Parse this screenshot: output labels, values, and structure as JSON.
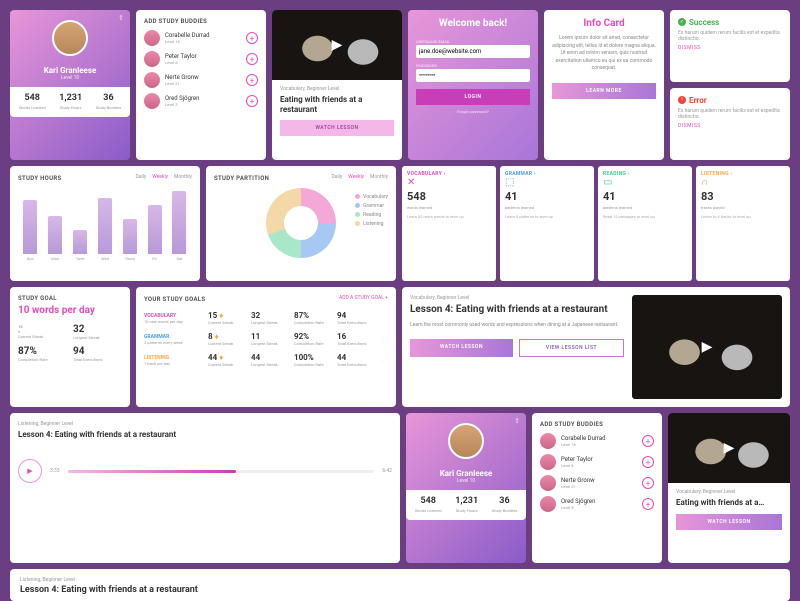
{
  "profile": {
    "name": "Kari Granleese",
    "level": "Level 10",
    "stats": [
      {
        "v": "548",
        "l": "Words Learned"
      },
      {
        "v": "1,231",
        "l": "Study Hours"
      },
      {
        "v": "36",
        "l": "Study Buddies"
      }
    ]
  },
  "buddies": {
    "title": "ADD STUDY BUDDIES",
    "list": [
      {
        "n": "Corabelle Durrad",
        "l": "Level 16"
      },
      {
        "n": "Peter Taylor",
        "l": "Level 8"
      },
      {
        "n": "Nerte Gronw",
        "l": "Level 21"
      },
      {
        "n": "Ored Sjögren",
        "l": "Level 5"
      }
    ]
  },
  "lesson1": {
    "tag": "Vocabulary, Beginner Level",
    "title": "Eating with friends at a restaurant",
    "btn": "WATCH LESSON"
  },
  "login": {
    "title": "Welcome back!",
    "u_label": "USERNAME/EMAIL",
    "u_val": "jane.doe@website.com",
    "p_label": "PASSWORD",
    "p_val": "••••••••",
    "btn": "LOGIN",
    "forgot": "Forgot password?"
  },
  "info": {
    "title": "Info Card",
    "body": "Lorem ipsum dolor sit amet, consectetur adipiscing elit, tellus id et dolore magna aliqua. Ut enim ad minim veniam, quis nostrud exercitation ullamco eu qui ex ea commodo consequat.",
    "btn": "LEARN MORE"
  },
  "notif_success": {
    "title": "Success",
    "body": "Es harum quidem rerum facilis est et expedita distinctio.",
    "btn": "DISMISS"
  },
  "notif_error": {
    "title": "Error",
    "body": "Es harum quidem rerum facilis est et expedita distinctio.",
    "btn": "DISMISS"
  },
  "study_hours": {
    "title": "STUDY HOURS",
    "tabs": [
      "Daily",
      "Weekly",
      "Monthly"
    ],
    "active": "Weekly"
  },
  "partition": {
    "title": "STUDY PARTITION",
    "tabs": [
      "Daily",
      "Weekly",
      "Monthly"
    ],
    "active": "Weekly",
    "legend": [
      "Vocabulary",
      "Grammar",
      "Reading",
      "Listening"
    ]
  },
  "metrics": {
    "vocab": {
      "t": "VOCABULARY ›",
      "v": "548",
      "s": "words learned",
      "h": "Learn 32 more words to level up"
    },
    "gram": {
      "t": "GRAMMAR ›",
      "v": "41",
      "s": "patterns learned",
      "h": "Learn 8 patterns to level up"
    },
    "read": {
      "t": "READING ›",
      "v": "41",
      "s": "patterns learned",
      "h": "Read 12 passages to level up"
    },
    "list": {
      "t": "LISTENING ›",
      "v": "83",
      "s": "tracks played",
      "h": "Listen to 4 tracks to level up"
    }
  },
  "goal": {
    "title": "STUDY GOAL",
    "main": "10 words per day",
    "stats": [
      {
        "v": "15",
        "l": "Current Streak",
        "flame": true
      },
      {
        "v": "32",
        "l": "Longest Streak"
      },
      {
        "v": "87%",
        "l": "Completion Rate"
      },
      {
        "v": "94",
        "l": "Total Executions"
      }
    ]
  },
  "goals": {
    "title": "YOUR STUDY GOALS",
    "add": "ADD A STUDY GOAL +",
    "rows": [
      {
        "cat": "VOCABULARY",
        "desc": "10 new words per day",
        "color": "#e84bb8",
        "c": [
          {
            "v": "15",
            "l": "Current Streak",
            "f": true
          },
          {
            "v": "32",
            "l": "Longest Streak"
          },
          {
            "v": "87%",
            "l": "Completion Rate"
          },
          {
            "v": "94",
            "l": "Total Executions"
          }
        ]
      },
      {
        "cat": "GRAMMAR",
        "desc": "2 patterns every week",
        "color": "#4a9fd8",
        "c": [
          {
            "v": "8",
            "l": "Current Streak",
            "f": true
          },
          {
            "v": "11",
            "l": "Longest Streak"
          },
          {
            "v": "92%",
            "l": "Completion Rate"
          },
          {
            "v": "16",
            "l": "Total Executions"
          }
        ]
      },
      {
        "cat": "LISTENING",
        "desc": "1 track per day",
        "color": "#f4a848",
        "c": [
          {
            "v": "44",
            "l": "Current Streak",
            "f": true
          },
          {
            "v": "44",
            "l": "Longest Streak"
          },
          {
            "v": "100%",
            "l": "Completion Rate"
          },
          {
            "v": "44",
            "l": "Total Executions"
          }
        ]
      }
    ]
  },
  "lesson2": {
    "tag": "Vocabulary, Beginner Level",
    "title": "Lesson 4: Eating with friends at a restaurant",
    "body": "Learn the most commonly used words and expressions when dining at a Japanese restaurant.",
    "b1": "WATCH LESSON",
    "b2": "VIEW LESSON LIST"
  },
  "player": {
    "tag": "Listening, Beginner Level",
    "title": "Lesson 4: Eating with friends at a restaurant",
    "cur": "3:33",
    "tot": "6:42"
  },
  "lesson3": {
    "tag": "Vocabulary, Beginner Level",
    "title": "Eating with friends at a…",
    "btn": "WATCH LESSON"
  },
  "lesson4": {
    "tag": "Listening, Beginner Level",
    "title": "Lesson 4: Eating with friends at a restaurant"
  },
  "chart_data": {
    "study_hours": {
      "type": "bar",
      "categories": [
        "Sun",
        "Mon",
        "Tues",
        "Wed",
        "Thurs",
        "Fri",
        "Sat"
      ],
      "values": [
        3.1,
        2.2,
        1.4,
        3.2,
        2.0,
        2.8,
        3.6
      ],
      "ylim": [
        0,
        4
      ],
      "title": "STUDY HOURS"
    },
    "partition": {
      "type": "pie",
      "series": [
        {
          "name": "Vocabulary",
          "value": 25,
          "color": "#f4a8d8"
        },
        {
          "name": "Grammar",
          "value": 25,
          "color": "#a8c8f4"
        },
        {
          "name": "Reading",
          "value": 20,
          "color": "#a8e8c8"
        },
        {
          "name": "Listening",
          "value": 30,
          "color": "#f4d8a8"
        }
      ],
      "title": "STUDY PARTITION"
    }
  }
}
